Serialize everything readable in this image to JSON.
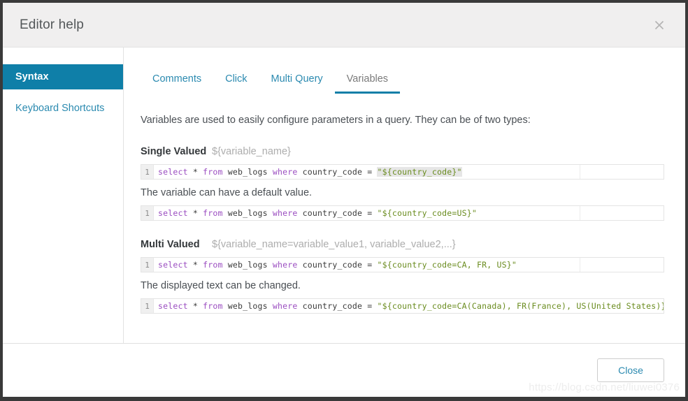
{
  "dialog": {
    "title": "Editor help",
    "close_icon": "close-icon"
  },
  "sidebar": {
    "items": [
      {
        "label": "Syntax",
        "active": true
      },
      {
        "label": "Keyboard Shortcuts",
        "active": false
      }
    ]
  },
  "tabs": [
    {
      "label": "Comments",
      "active": false
    },
    {
      "label": "Click",
      "active": false
    },
    {
      "label": "Multi Query",
      "active": false
    },
    {
      "label": "Variables",
      "active": true
    }
  ],
  "main": {
    "intro": "Variables are used to easily configure parameters in a query. They can be of two types:",
    "single": {
      "name": "Single Valued",
      "syntax": "${variable_name}",
      "note": "The variable can have a default value."
    },
    "multi": {
      "name": "Multi Valued",
      "syntax": "${variable_name=variable_value1, variable_value2,...}",
      "note": "The displayed text can be changed."
    },
    "code_blocks": [
      {
        "line_number": "1",
        "prefix_kw1": "select",
        "star": " * ",
        "kw2": "from",
        "table": " web_logs ",
        "kw3": "where",
        "expr": " country_code = ",
        "string": "\"${country_code}\""
      },
      {
        "line_number": "1",
        "prefix_kw1": "select",
        "star": " * ",
        "kw2": "from",
        "table": " web_logs ",
        "kw3": "where",
        "expr": " country_code = ",
        "string": "\"${country_code=US}\""
      },
      {
        "line_number": "1",
        "prefix_kw1": "select",
        "star": " * ",
        "kw2": "from",
        "table": " web_logs ",
        "kw3": "where",
        "expr": " country_code = ",
        "string": "\"${country_code=CA, FR, US}\""
      },
      {
        "line_number": "1",
        "prefix_kw1": "select",
        "star": " * ",
        "kw2": "from",
        "table": " web_logs ",
        "kw3": "where",
        "expr": " country_code = ",
        "string": "\"${country_code=CA(Canada), FR(France), US(United States)}\""
      }
    ]
  },
  "footer": {
    "close_label": "Close",
    "watermark": "https://blog.csdn.net/liuwei0376"
  },
  "colors": {
    "accent": "#0f7fa8",
    "link": "#2b8ab0",
    "keyword": "#9b4ec1",
    "string": "#6a8c1f",
    "header_bg": "#f0efef"
  }
}
